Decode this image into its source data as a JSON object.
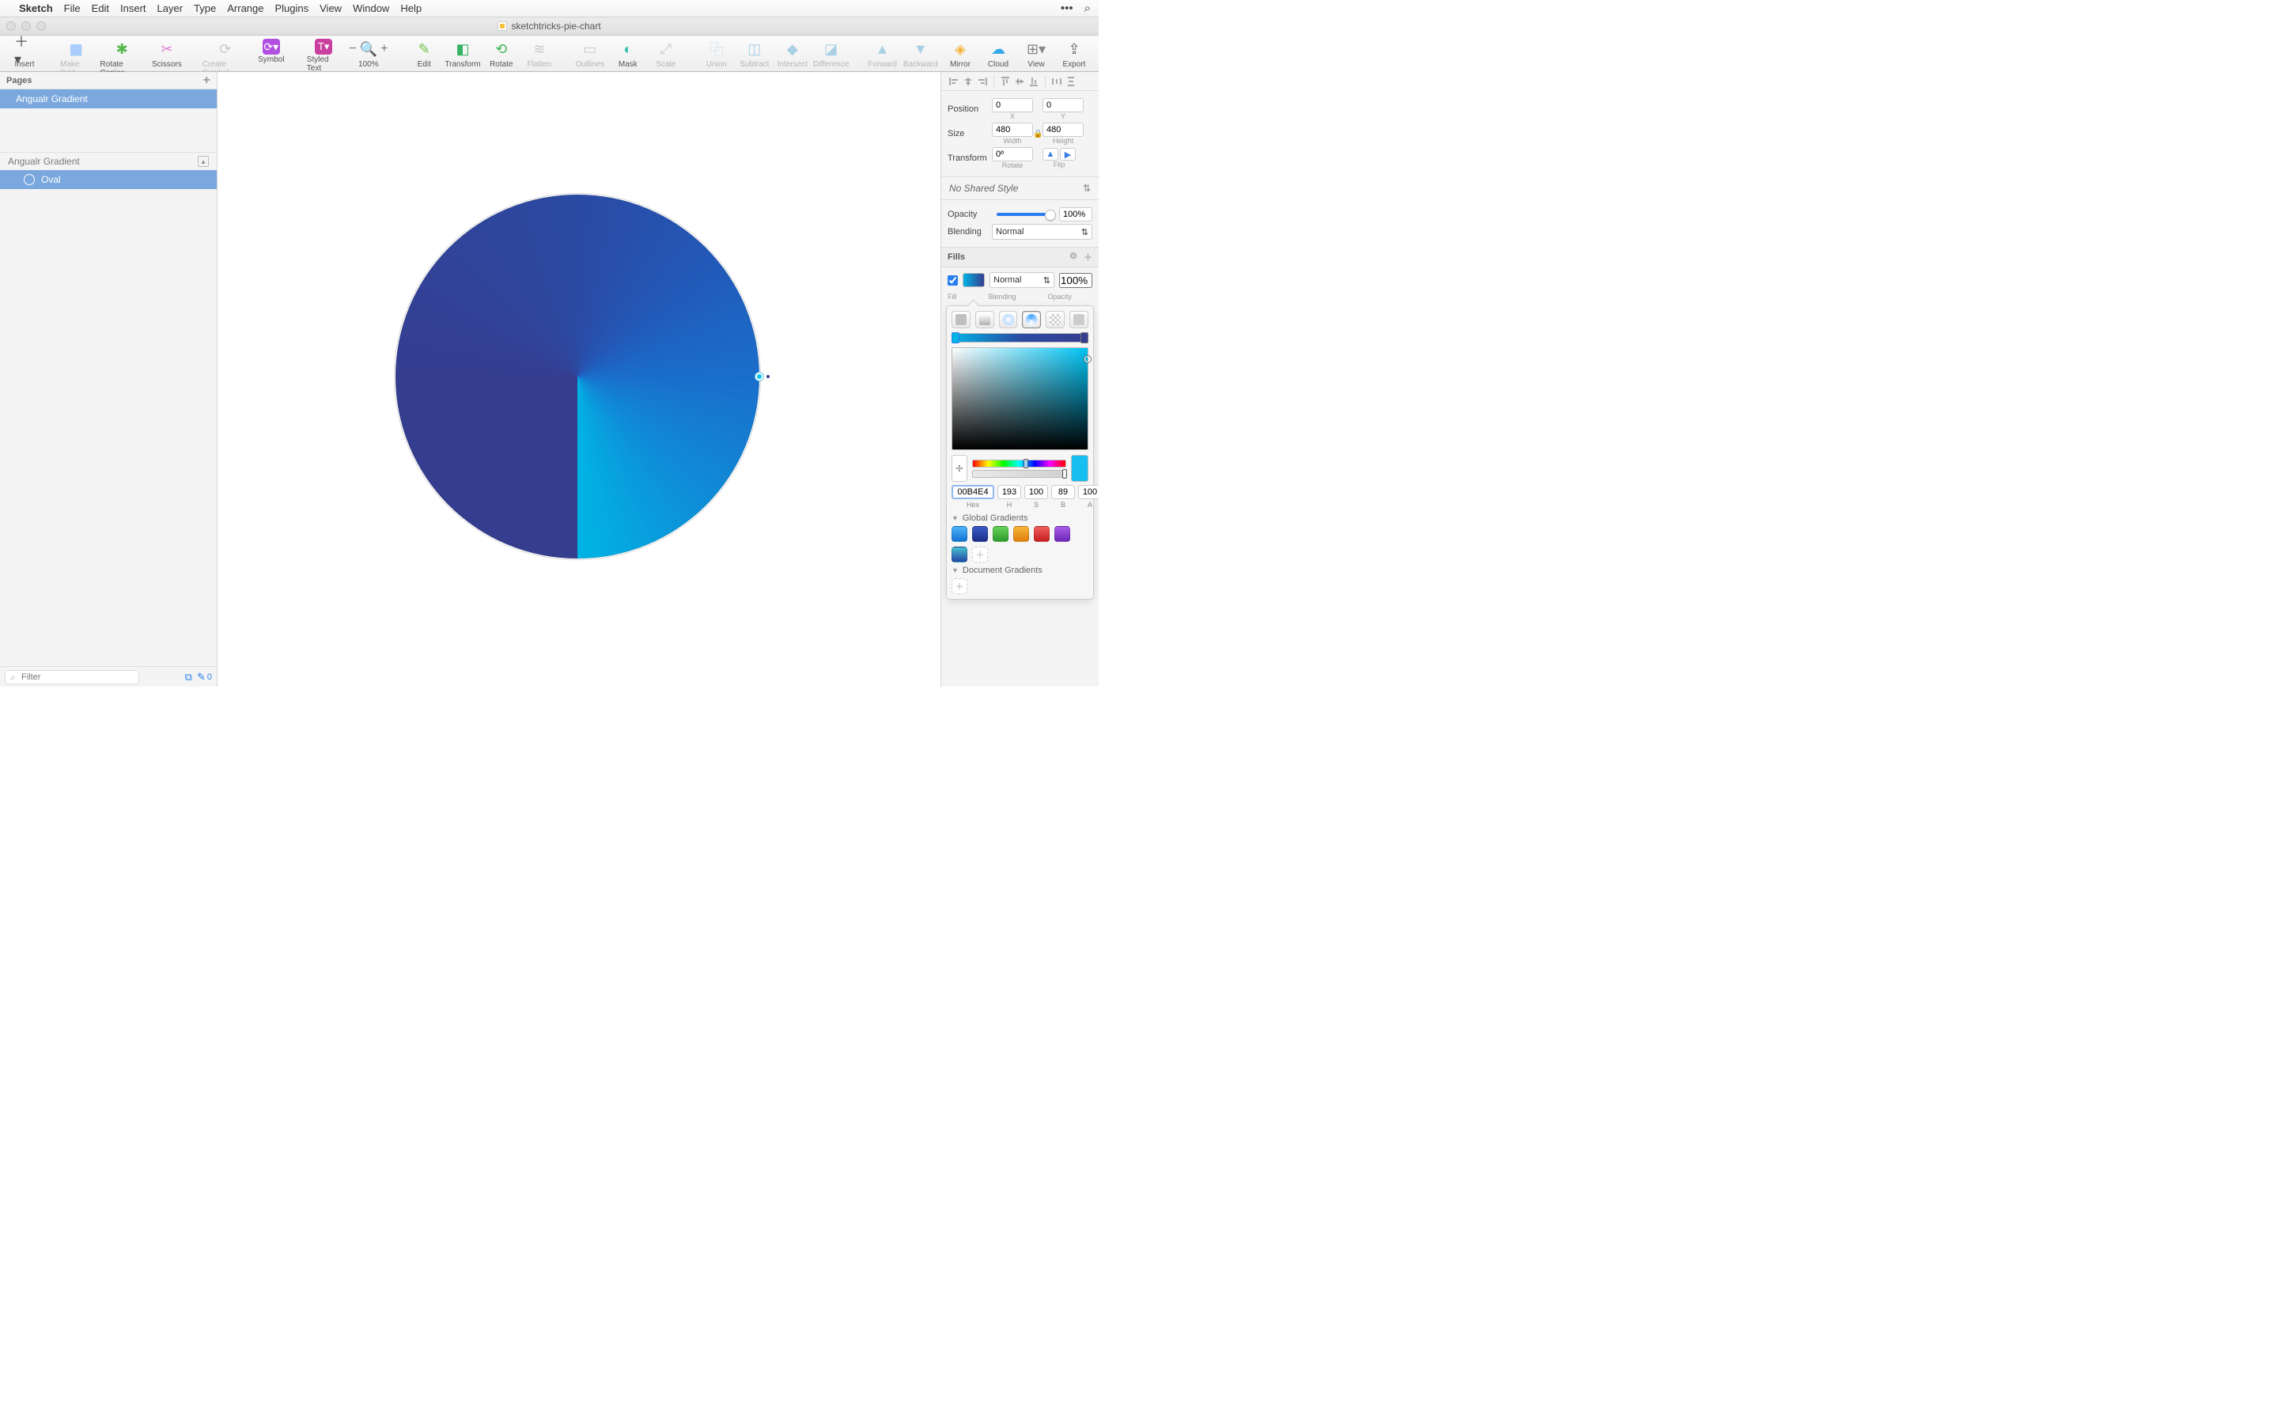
{
  "menu": {
    "app": "Sketch",
    "items": [
      "File",
      "Edit",
      "Insert",
      "Layer",
      "Type",
      "Arrange",
      "Plugins",
      "View",
      "Window",
      "Help"
    ]
  },
  "window": {
    "title": "sketchtricks-pie-chart"
  },
  "toolbar": {
    "insert": "Insert",
    "make_grid": "Make Grid",
    "rotate_copies": "Rotate Copies",
    "scissors": "Scissors",
    "create_symbol": "Create Symbol",
    "symbol": "Symbol",
    "styled_text": "Styled Text",
    "zoom": "100%",
    "edit": "Edit",
    "transform": "Transform",
    "rotate": "Rotate",
    "flatten": "Flatten",
    "outlines": "Outlines",
    "mask": "Mask",
    "scale": "Scale",
    "union": "Union",
    "subtract": "Subtract",
    "intersect": "Intersect",
    "difference": "Difference",
    "forward": "Forward",
    "backward": "Backward",
    "mirror": "Mirror",
    "cloud": "Cloud",
    "view": "View",
    "export": "Export"
  },
  "left": {
    "pages_header": "Pages",
    "page_name": "Angualr Gradient",
    "artboard_name": "Angualr Gradient",
    "layer_name": "Oval",
    "filter_placeholder": "Filter",
    "footer_count": "0"
  },
  "inspector": {
    "position_label": "Position",
    "x": "0",
    "y": "0",
    "x_label": "X",
    "y_label": "Y",
    "size_label": "Size",
    "width": "480",
    "height": "480",
    "width_label": "Width",
    "height_label": "Height",
    "transform_label": "Transform",
    "rotate": "0º",
    "rotate_label": "Rotate",
    "flip_label": "Flip",
    "shared_style": "No Shared Style",
    "opacity_label": "Opacity",
    "opacity_value": "100%",
    "blending_label": "Blending",
    "blending_value": "Normal",
    "fills_header": "Fills",
    "fill_blend": "Normal",
    "fill_opacity": "100%",
    "fill_sub_fill": "Fill",
    "fill_sub_blend": "Blending",
    "fill_sub_op": "Opacity",
    "hex": "00B4E4",
    "h": "193",
    "s": "100",
    "b": "89",
    "a": "100",
    "hsba_labels": {
      "hex": "Hex",
      "h": "H",
      "s": "S",
      "b": "B",
      "a": "A"
    },
    "global_gradients": "Global Gradients",
    "document_gradients": "Document Gradients",
    "global_swatches": [
      "#1e9ff2",
      "#2b4fb0",
      "#45c24a",
      "#f39c1f",
      "#e13838",
      "#8e3fd1",
      "#2f9bb8"
    ]
  }
}
